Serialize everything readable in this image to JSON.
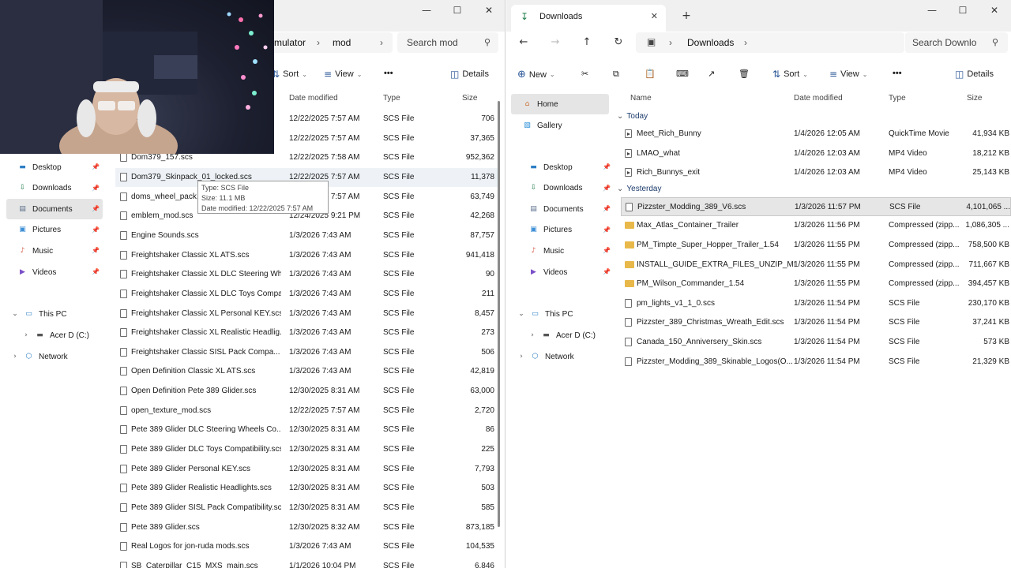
{
  "left": {
    "breadcrumb": [
      "mulator",
      "mod"
    ],
    "search_placeholder": "Search mod",
    "commands": {
      "sort": "Sort",
      "view": "View",
      "more": "•••",
      "details": "Details"
    },
    "columns": {
      "date": "Date modified",
      "type": "Type",
      "size": "Size"
    },
    "sidebar": [
      {
        "label": "Desktop",
        "icon": "desktop-icon",
        "pinned": true
      },
      {
        "label": "Downloads",
        "icon": "download-icon",
        "pinned": true
      },
      {
        "label": "Documents",
        "icon": "documents-icon",
        "pinned": true
      },
      {
        "label": "Pictures",
        "icon": "pictures-icon",
        "pinned": true
      },
      {
        "label": "Music",
        "icon": "music-icon",
        "pinned": true
      },
      {
        "label": "Videos",
        "icon": "videos-icon",
        "pinned": true
      }
    ],
    "tree": [
      {
        "label": "This PC",
        "icon": "pc-icon",
        "chev": "⌄"
      },
      {
        "label": "Acer D  (C:)",
        "icon": "drive-icon",
        "chev": "›"
      },
      {
        "label": "Network",
        "icon": "network-icon",
        "chev": "›"
      }
    ],
    "files": [
      {
        "name": "",
        "date": "12/22/2025 7:57 AM",
        "type": "SCS File",
        "size": "706"
      },
      {
        "name": "",
        "date": "12/22/2025 7:57 AM",
        "type": "SCS File",
        "size": "37,365"
      },
      {
        "name": "Dom379_157.scs",
        "date": "12/22/2025 7:58 AM",
        "type": "SCS File",
        "size": "952,362"
      },
      {
        "name": "Dom379_Skinpack_01_locked.scs",
        "date": "12/22/2025 7:57 AM",
        "type": "SCS File",
        "size": "11,378"
      },
      {
        "name": "doms_wheel_pack.s",
        "date": "12/22/2025 7:57 AM",
        "type": "SCS File",
        "size": "63,749"
      },
      {
        "name": "emblem_mod.scs",
        "date": "12/24/2025 9:21 PM",
        "type": "SCS File",
        "size": "42,268"
      },
      {
        "name": "Engine Sounds.scs",
        "date": "1/3/2026 7:43 AM",
        "type": "SCS File",
        "size": "87,757"
      },
      {
        "name": "Freightshaker Classic XL ATS.scs",
        "date": "1/3/2026 7:43 AM",
        "type": "SCS File",
        "size": "941,418"
      },
      {
        "name": "Freightshaker Classic XL DLC Steering Wh...",
        "date": "1/3/2026 7:43 AM",
        "type": "SCS File",
        "size": "90"
      },
      {
        "name": "Freightshaker Classic XL DLC Toys Compa...",
        "date": "1/3/2026 7:43 AM",
        "type": "SCS File",
        "size": "211"
      },
      {
        "name": "Freightshaker Classic XL Personal KEY.scs",
        "date": "1/3/2026 7:43 AM",
        "type": "SCS File",
        "size": "8,457"
      },
      {
        "name": "Freightshaker Classic XL Realistic Headlig...",
        "date": "1/3/2026 7:43 AM",
        "type": "SCS File",
        "size": "273"
      },
      {
        "name": "Freightshaker Classic SISL Pack Compa...",
        "date": "1/3/2026 7:43 AM",
        "type": "SCS File",
        "size": "506"
      },
      {
        "name": "Open Definition Classic XL ATS.scs",
        "date": "1/3/2026 7:43 AM",
        "type": "SCS File",
        "size": "42,819"
      },
      {
        "name": "Open Definition Pete 389 Glider.scs",
        "date": "12/30/2025 8:31 AM",
        "type": "SCS File",
        "size": "63,000"
      },
      {
        "name": "open_texture_mod.scs",
        "date": "12/22/2025 7:57 AM",
        "type": "SCS File",
        "size": "2,720"
      },
      {
        "name": "Pete 389 Glider DLC Steering Wheels Co...",
        "date": "12/30/2025 8:31 AM",
        "type": "SCS File",
        "size": "86"
      },
      {
        "name": "Pete 389 Glider DLC Toys Compatibility.scs",
        "date": "12/30/2025 8:31 AM",
        "type": "SCS File",
        "size": "225"
      },
      {
        "name": "Pete 389 Glider Personal KEY.scs",
        "date": "12/30/2025 8:31 AM",
        "type": "SCS File",
        "size": "7,793"
      },
      {
        "name": "Pete 389 Glider Realistic Headlights.scs",
        "date": "12/30/2025 8:31 AM",
        "type": "SCS File",
        "size": "503"
      },
      {
        "name": "Pete 389 Glider SISL Pack Compatibility.scs",
        "date": "12/30/2025 8:31 AM",
        "type": "SCS File",
        "size": "585"
      },
      {
        "name": "Pete 389 Glider.scs",
        "date": "12/30/2025 8:32 AM",
        "type": "SCS File",
        "size": "873,185"
      },
      {
        "name": "Real Logos for jon-ruda mods.scs",
        "date": "1/3/2026 7:43 AM",
        "type": "SCS File",
        "size": "104,535"
      },
      {
        "name": "SB_Caterpillar_C15_MXS_main.scs",
        "date": "1/1/2026 10:04 PM",
        "type": "SCS File",
        "size": "6,846"
      }
    ],
    "tooltip": {
      "type": "Type: SCS File",
      "size": "Size: 11.1 MB",
      "date": "Date modified: 12/22/2025 7:57 AM"
    }
  },
  "right": {
    "tab_title": "Downloads",
    "breadcrumb": "Downloads",
    "search_placeholder": "Search Downlo",
    "commands": {
      "new": "New",
      "sort": "Sort",
      "view": "View",
      "more": "•••",
      "details": "Details"
    },
    "columns": {
      "name": "Name",
      "date": "Date modified",
      "type": "Type",
      "size": "Size"
    },
    "sidebar_top": [
      {
        "label": "Home",
        "icon": "home-icon"
      },
      {
        "label": "Gallery",
        "icon": "gallery-icon"
      }
    ],
    "sidebar": [
      {
        "label": "Desktop",
        "icon": "desktop-icon"
      },
      {
        "label": "Downloads",
        "icon": "download-icon"
      },
      {
        "label": "Documents",
        "icon": "documents-icon"
      },
      {
        "label": "Pictures",
        "icon": "pictures-icon"
      },
      {
        "label": "Music",
        "icon": "music-icon"
      },
      {
        "label": "Videos",
        "icon": "videos-icon"
      }
    ],
    "tree": [
      {
        "label": "This PC",
        "icon": "pc-icon",
        "chev": "⌄"
      },
      {
        "label": "Acer D  (C:)",
        "icon": "drive-icon",
        "chev": "›"
      },
      {
        "label": "Network",
        "icon": "network-icon",
        "chev": "›"
      }
    ],
    "groups": [
      {
        "label": "Today",
        "files": [
          {
            "name": "Meet_Rich_Bunny",
            "date": "1/4/2026 12:05 AM",
            "type": "QuickTime Movie",
            "size": "41,934 KB",
            "kind": "video"
          },
          {
            "name": "LMAO_what",
            "date": "1/4/2026 12:03 AM",
            "type": "MP4 Video",
            "size": "18,212 KB",
            "kind": "video"
          },
          {
            "name": "Rich_Bunnys_exit",
            "date": "1/4/2026 12:03 AM",
            "type": "MP4 Video",
            "size": "25,143 KB",
            "kind": "video"
          }
        ]
      },
      {
        "label": "Yesterday",
        "files": [
          {
            "name": "Pizzster_Modding_389_V6.scs",
            "date": "1/3/2026 11:57 PM",
            "type": "SCS File",
            "size": "4,101,065 ...",
            "kind": "file"
          },
          {
            "name": "Max_Atlas_Container_Trailer",
            "date": "1/3/2026 11:56 PM",
            "type": "Compressed (zipp...",
            "size": "1,086,305 ...",
            "kind": "zip"
          },
          {
            "name": "PM_Timpte_Super_Hopper_Trailer_1.54",
            "date": "1/3/2026 11:55 PM",
            "type": "Compressed (zipp...",
            "size": "758,500 KB",
            "kind": "zip"
          },
          {
            "name": "INSTALL_GUIDE_EXTRA_FILES_UNZIP_ME",
            "date": "1/3/2026 11:55 PM",
            "type": "Compressed (zipp...",
            "size": "711,667 KB",
            "kind": "zip"
          },
          {
            "name": "PM_Wilson_Commander_1.54",
            "date": "1/3/2026 11:55 PM",
            "type": "Compressed (zipp...",
            "size": "394,457 KB",
            "kind": "zip"
          },
          {
            "name": "pm_lights_v1_1_0.scs",
            "date": "1/3/2026 11:54 PM",
            "type": "SCS File",
            "size": "230,170 KB",
            "kind": "file"
          },
          {
            "name": "Pizzster_389_Christmas_Wreath_Edit.scs",
            "date": "1/3/2026 11:54 PM",
            "type": "SCS File",
            "size": "37,241 KB",
            "kind": "file"
          },
          {
            "name": "Canada_150_Anniversery_Skin.scs",
            "date": "1/3/2026 11:54 PM",
            "type": "SCS File",
            "size": "573 KB",
            "kind": "file"
          },
          {
            "name": "Pizzster_Modding_389_Skinable_Logos(O...",
            "date": "1/3/2026 11:54 PM",
            "type": "SCS File",
            "size": "21,329 KB",
            "kind": "file"
          }
        ]
      }
    ]
  },
  "colors": {
    "accent": "#2b5797",
    "selection": "#e6e6e6",
    "tabstrip": "#f0f0f0",
    "zip": "#e8b84a"
  }
}
